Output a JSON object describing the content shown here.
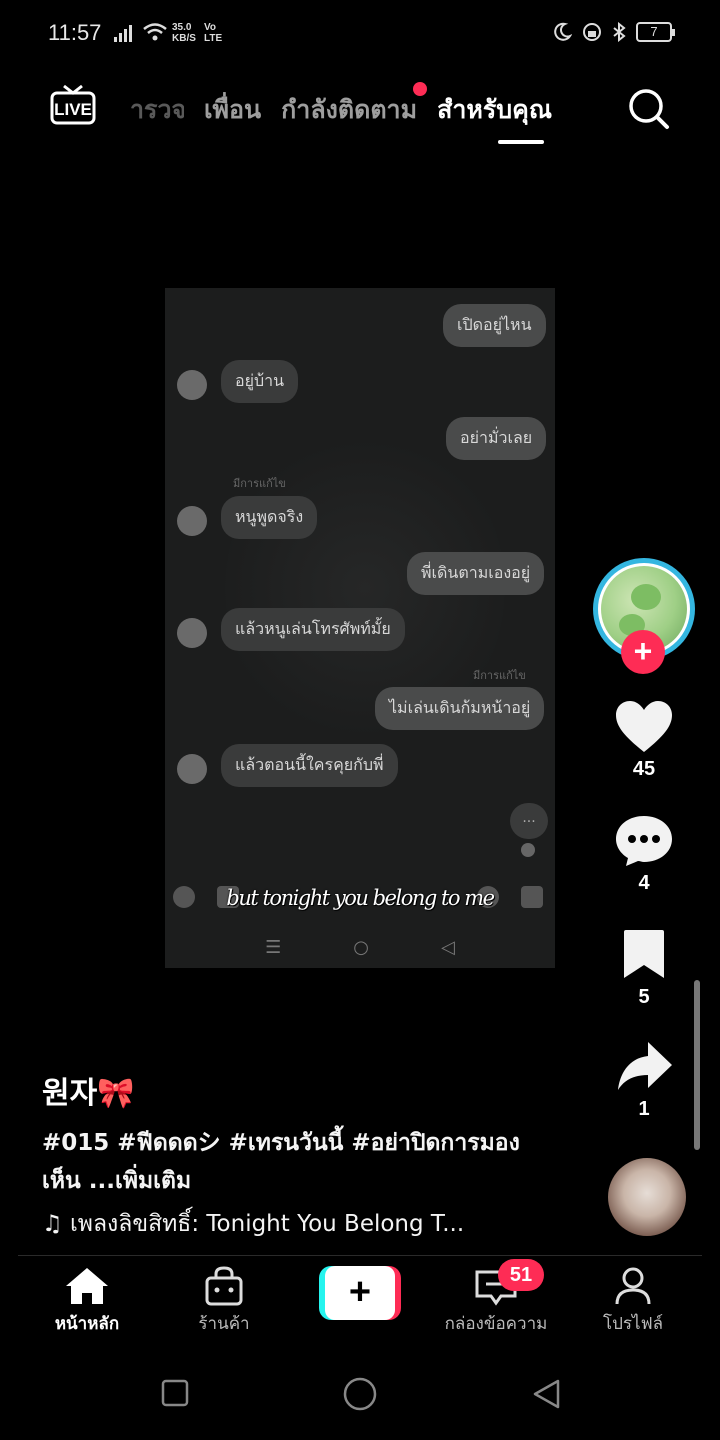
{
  "status_bar": {
    "time": "11:57",
    "net_speed_value": "35.0",
    "net_speed_unit": "KB/S",
    "volte_top": "Vo",
    "volte_bottom": "LTE",
    "battery": "7"
  },
  "top_nav": {
    "live_label": "LIVE",
    "tabs": [
      {
        "label": "สำรวจ",
        "visible": "ารวจ"
      },
      {
        "label": "เพื่อน"
      },
      {
        "label": "กำลังติดตาม"
      },
      {
        "label": "สำหรับคุณ"
      }
    ]
  },
  "video": {
    "messages": [
      {
        "text": "เปิดอยู่ไหน",
        "side": "me"
      },
      {
        "text": "อยู่บ้าน",
        "side": "them"
      },
      {
        "text": "อย่ามั่วเลย",
        "side": "me"
      },
      {
        "text": "หนูพูดจริง",
        "side": "them"
      },
      {
        "text": "พี่เดินตามเองอยู่",
        "side": "me"
      },
      {
        "text": "แล้วหนูเล่นโทรศัพท์มั้ย",
        "side": "them"
      },
      {
        "text": "ไม่เล่นเดินก้มหน้าอยู่",
        "side": "me"
      },
      {
        "text": "แล้วตอนนี้ใครคุยกับพี่",
        "side": "them"
      }
    ],
    "edited_label": "มีการแก้ไข",
    "typing": "...",
    "caption": "but tonight you belong to me"
  },
  "right_rail": {
    "follow": "+",
    "likes": "45",
    "comments": "4",
    "bookmarks": "5",
    "shares": "1"
  },
  "post": {
    "author": "원자🎀",
    "description": "#015 #ฟีดดดシ #เทรนวันนี้ #อย่าปิดการมองเห็น ...เพิ่มเติม",
    "music_icon": "♫",
    "music": "เพลงลิขสิทธิ์: Tonight You Belong T..."
  },
  "tab_bar": {
    "home": "หน้าหลัก",
    "shop": "ร้านค้า",
    "create": "+",
    "inbox": "กล่องข้อความ",
    "inbox_badge": "51",
    "profile": "โปรไฟล์"
  },
  "colors": {
    "accent": "#fe2c55",
    "cyan": "#25f4ee",
    "ring": "#34b6e0"
  }
}
